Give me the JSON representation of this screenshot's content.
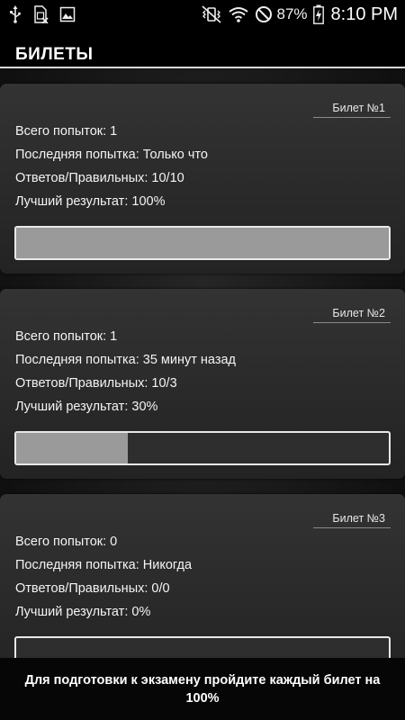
{
  "status_bar": {
    "left_icons": [
      "usb-icon",
      "sim-card-icon",
      "image-icon"
    ],
    "right_icons": [
      "vibrate-icon",
      "wifi-icon",
      "block-icon",
      "battery-charging-icon"
    ],
    "battery": "87%",
    "time": "8:10 PM"
  },
  "header": {
    "title": "БИЛЕТЫ"
  },
  "tickets": [
    {
      "tag": "Билет №1",
      "attempts": "Всего попыток: 1",
      "last_attempt": "Последняя попытка: Только что",
      "answers": "Ответов/Правильных: 10/10",
      "best": "Лучший результат: 100%",
      "progress_percent": 100
    },
    {
      "tag": "Билет №2",
      "attempts": "Всего попыток: 1",
      "last_attempt": "Последняя попытка: 35 минут назад",
      "answers": "Ответов/Правильных: 10/3",
      "best": "Лучший результат: 30%",
      "progress_percent": 30
    },
    {
      "tag": "Билет №3",
      "attempts": "Всего попыток: 0",
      "last_attempt": "Последняя попытка: Никогда",
      "answers": "Ответов/Правильных: 0/0",
      "best": "Лучший результат: 0%",
      "progress_percent": 0
    }
  ],
  "toast": {
    "text": "Для подготовки к экзамену пройдите каждый билет на 100%"
  },
  "colors": {
    "background": "#141414",
    "card": "#2d2d2d",
    "progress_fill": "#9a9a9a",
    "text": "#ffffff"
  }
}
